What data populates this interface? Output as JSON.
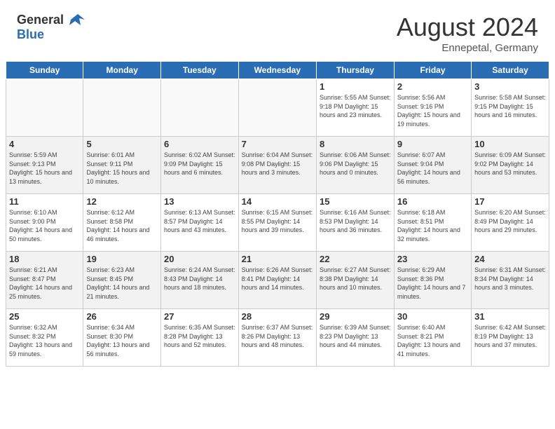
{
  "header": {
    "logo_general": "General",
    "logo_blue": "Blue",
    "month_year": "August 2024",
    "location": "Ennepetal, Germany"
  },
  "days_of_week": [
    "Sunday",
    "Monday",
    "Tuesday",
    "Wednesday",
    "Thursday",
    "Friday",
    "Saturday"
  ],
  "weeks": [
    [
      {
        "day": "",
        "info": ""
      },
      {
        "day": "",
        "info": ""
      },
      {
        "day": "",
        "info": ""
      },
      {
        "day": "",
        "info": ""
      },
      {
        "day": "1",
        "info": "Sunrise: 5:55 AM\nSunset: 9:18 PM\nDaylight: 15 hours\nand 23 minutes."
      },
      {
        "day": "2",
        "info": "Sunrise: 5:56 AM\nSunset: 9:16 PM\nDaylight: 15 hours\nand 19 minutes."
      },
      {
        "day": "3",
        "info": "Sunrise: 5:58 AM\nSunset: 9:15 PM\nDaylight: 15 hours\nand 16 minutes."
      }
    ],
    [
      {
        "day": "4",
        "info": "Sunrise: 5:59 AM\nSunset: 9:13 PM\nDaylight: 15 hours\nand 13 minutes."
      },
      {
        "day": "5",
        "info": "Sunrise: 6:01 AM\nSunset: 9:11 PM\nDaylight: 15 hours\nand 10 minutes."
      },
      {
        "day": "6",
        "info": "Sunrise: 6:02 AM\nSunset: 9:09 PM\nDaylight: 15 hours\nand 6 minutes."
      },
      {
        "day": "7",
        "info": "Sunrise: 6:04 AM\nSunset: 9:08 PM\nDaylight: 15 hours\nand 3 minutes."
      },
      {
        "day": "8",
        "info": "Sunrise: 6:06 AM\nSunset: 9:06 PM\nDaylight: 15 hours\nand 0 minutes."
      },
      {
        "day": "9",
        "info": "Sunrise: 6:07 AM\nSunset: 9:04 PM\nDaylight: 14 hours\nand 56 minutes."
      },
      {
        "day": "10",
        "info": "Sunrise: 6:09 AM\nSunset: 9:02 PM\nDaylight: 14 hours\nand 53 minutes."
      }
    ],
    [
      {
        "day": "11",
        "info": "Sunrise: 6:10 AM\nSunset: 9:00 PM\nDaylight: 14 hours\nand 50 minutes."
      },
      {
        "day": "12",
        "info": "Sunrise: 6:12 AM\nSunset: 8:58 PM\nDaylight: 14 hours\nand 46 minutes."
      },
      {
        "day": "13",
        "info": "Sunrise: 6:13 AM\nSunset: 8:57 PM\nDaylight: 14 hours\nand 43 minutes."
      },
      {
        "day": "14",
        "info": "Sunrise: 6:15 AM\nSunset: 8:55 PM\nDaylight: 14 hours\nand 39 minutes."
      },
      {
        "day": "15",
        "info": "Sunrise: 6:16 AM\nSunset: 8:53 PM\nDaylight: 14 hours\nand 36 minutes."
      },
      {
        "day": "16",
        "info": "Sunrise: 6:18 AM\nSunset: 8:51 PM\nDaylight: 14 hours\nand 32 minutes."
      },
      {
        "day": "17",
        "info": "Sunrise: 6:20 AM\nSunset: 8:49 PM\nDaylight: 14 hours\nand 29 minutes."
      }
    ],
    [
      {
        "day": "18",
        "info": "Sunrise: 6:21 AM\nSunset: 8:47 PM\nDaylight: 14 hours\nand 25 minutes."
      },
      {
        "day": "19",
        "info": "Sunrise: 6:23 AM\nSunset: 8:45 PM\nDaylight: 14 hours\nand 21 minutes."
      },
      {
        "day": "20",
        "info": "Sunrise: 6:24 AM\nSunset: 8:43 PM\nDaylight: 14 hours\nand 18 minutes."
      },
      {
        "day": "21",
        "info": "Sunrise: 6:26 AM\nSunset: 8:41 PM\nDaylight: 14 hours\nand 14 minutes."
      },
      {
        "day": "22",
        "info": "Sunrise: 6:27 AM\nSunset: 8:38 PM\nDaylight: 14 hours\nand 10 minutes."
      },
      {
        "day": "23",
        "info": "Sunrise: 6:29 AM\nSunset: 8:36 PM\nDaylight: 14 hours\nand 7 minutes."
      },
      {
        "day": "24",
        "info": "Sunrise: 6:31 AM\nSunset: 8:34 PM\nDaylight: 14 hours\nand 3 minutes."
      }
    ],
    [
      {
        "day": "25",
        "info": "Sunrise: 6:32 AM\nSunset: 8:32 PM\nDaylight: 13 hours\nand 59 minutes."
      },
      {
        "day": "26",
        "info": "Sunrise: 6:34 AM\nSunset: 8:30 PM\nDaylight: 13 hours\nand 56 minutes."
      },
      {
        "day": "27",
        "info": "Sunrise: 6:35 AM\nSunset: 8:28 PM\nDaylight: 13 hours\nand 52 minutes."
      },
      {
        "day": "28",
        "info": "Sunrise: 6:37 AM\nSunset: 8:26 PM\nDaylight: 13 hours\nand 48 minutes."
      },
      {
        "day": "29",
        "info": "Sunrise: 6:39 AM\nSunset: 8:23 PM\nDaylight: 13 hours\nand 44 minutes."
      },
      {
        "day": "30",
        "info": "Sunrise: 6:40 AM\nSunset: 8:21 PM\nDaylight: 13 hours\nand 41 minutes."
      },
      {
        "day": "31",
        "info": "Sunrise: 6:42 AM\nSunset: 8:19 PM\nDaylight: 13 hours\nand 37 minutes."
      }
    ]
  ]
}
